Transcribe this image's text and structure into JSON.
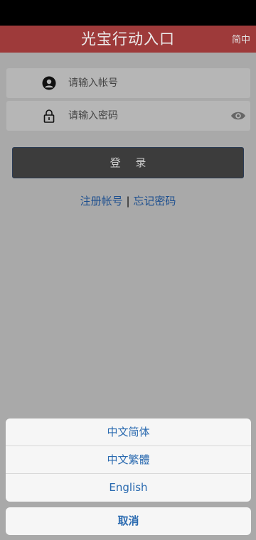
{
  "header": {
    "title": "光宝行动入口",
    "lang_toggle": "简中"
  },
  "login": {
    "username_placeholder": "请输入帐号",
    "password_placeholder": "请输入密码",
    "login_label": "登 录"
  },
  "links": {
    "register": "注册帐号",
    "separator": "|",
    "forgot": "忘记密码"
  },
  "language_sheet": {
    "options": [
      "中文简体",
      "中文繁體",
      "English"
    ],
    "cancel": "取消"
  },
  "colors": {
    "header": "#9e3a3a",
    "link": "#1d4f8f",
    "sheet_text": "#2a6ab0",
    "button": "#3c3c3c"
  },
  "icons": {
    "user": "user-icon",
    "lock": "lock-icon",
    "eye": "eye-icon"
  }
}
